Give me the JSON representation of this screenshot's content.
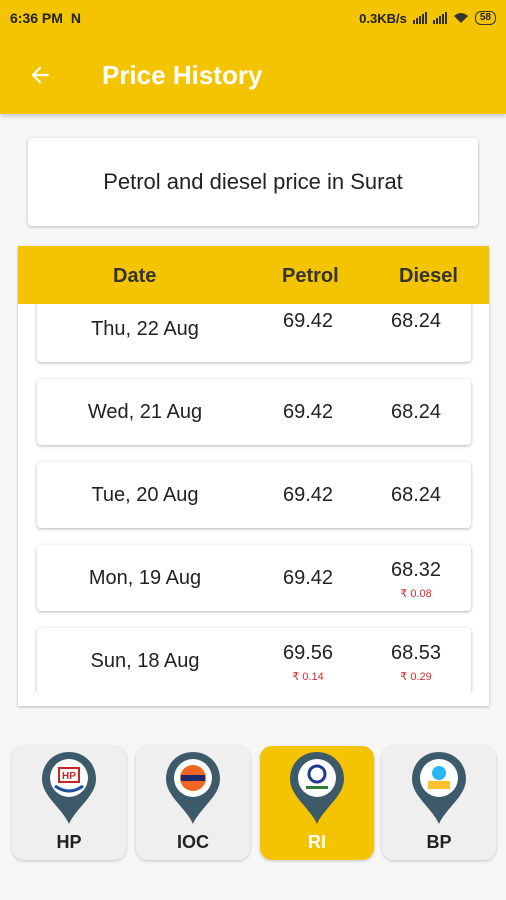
{
  "status": {
    "time": "6:36 PM",
    "speed": "0.3KB/s",
    "battery": "58"
  },
  "appbar": {
    "title": "Price History"
  },
  "city_card": {
    "text": "Petrol and diesel price in Surat"
  },
  "table": {
    "headers": {
      "date": "Date",
      "petrol": "Petrol",
      "diesel": "Diesel"
    },
    "rows": [
      {
        "date": "Thu, 22 Aug",
        "petrol": "69.42",
        "petrol_change": "",
        "diesel": "68.24",
        "diesel_change": ""
      },
      {
        "date": "Wed, 21 Aug",
        "petrol": "69.42",
        "petrol_change": "",
        "diesel": "68.24",
        "diesel_change": ""
      },
      {
        "date": "Tue, 20 Aug",
        "petrol": "69.42",
        "petrol_change": "",
        "diesel": "68.24",
        "diesel_change": ""
      },
      {
        "date": "Mon, 19 Aug",
        "petrol": "69.42",
        "petrol_change": "",
        "diesel": "68.32",
        "diesel_change": "₹ 0.08"
      },
      {
        "date": "Sun, 18 Aug",
        "petrol": "69.56",
        "petrol_change": "₹ 0.14",
        "diesel": "68.53",
        "diesel_change": "₹ 0.29"
      }
    ]
  },
  "companies": [
    {
      "name": "HP",
      "icon": "hp-logo-pin-icon",
      "selected": false
    },
    {
      "name": "IOC",
      "icon": "ioc-logo-pin-icon",
      "selected": false
    },
    {
      "name": "RI",
      "icon": "reliance-logo-pin-icon",
      "selected": true
    },
    {
      "name": "BP",
      "icon": "bp-logo-pin-icon",
      "selected": false
    }
  ],
  "colors": {
    "accent": "#f4c400",
    "change": "#d32f2f"
  }
}
